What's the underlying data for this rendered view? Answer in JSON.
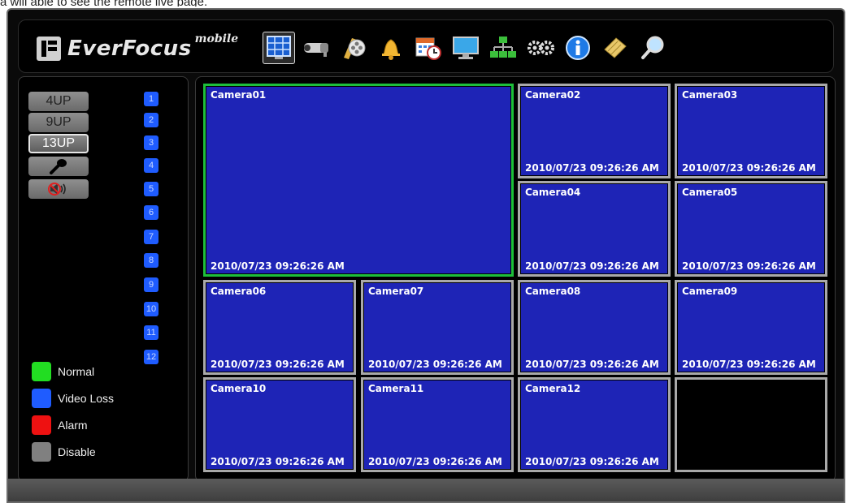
{
  "caption": "a will able to see the remote live page.",
  "header": {
    "brand": "EverFocus",
    "brand_sup": "mobile"
  },
  "toolbar": [
    {
      "icon": "live-view-grid-icon",
      "active": true
    },
    {
      "icon": "camera-icon",
      "active": false
    },
    {
      "icon": "film-reel-icon",
      "active": false
    },
    {
      "icon": "alarm-bell-icon",
      "active": false
    },
    {
      "icon": "calendar-clock-icon",
      "active": false
    },
    {
      "icon": "monitor-icon",
      "active": false
    },
    {
      "icon": "network-icon",
      "active": false
    },
    {
      "icon": "settings-gears-icon",
      "active": false
    },
    {
      "icon": "info-icon",
      "active": false
    },
    {
      "icon": "notes-icon",
      "active": false
    },
    {
      "icon": "search-icon",
      "active": false
    }
  ],
  "layouts": {
    "btn_4up": "4UP",
    "btn_9up": "9UP",
    "btn_13up": "13UP",
    "selected": "13UP"
  },
  "controls": {
    "mic_icon": "microphone-icon",
    "audio_icon": "speaker-muted-icon"
  },
  "channels": [
    "1",
    "2",
    "3",
    "4",
    "5",
    "6",
    "7",
    "8",
    "9",
    "10",
    "11",
    "12"
  ],
  "legend": [
    {
      "label": "Normal",
      "color": "#22dd22"
    },
    {
      "label": "Video Loss",
      "color": "#1f5cff"
    },
    {
      "label": "Alarm",
      "color": "#ee1111"
    },
    {
      "label": "Disable",
      "color": "#808080"
    }
  ],
  "cameras": [
    {
      "name": "Camera01",
      "timestamp": "2010/07/23  09:26:26 AM"
    },
    {
      "name": "Camera02",
      "timestamp": "2010/07/23  09:26:26 AM"
    },
    {
      "name": "Camera03",
      "timestamp": "2010/07/23  09:26:26 AM"
    },
    {
      "name": "Camera04",
      "timestamp": "2010/07/23  09:26:26 AM"
    },
    {
      "name": "Camera05",
      "timestamp": "2010/07/23  09:26:26 AM"
    },
    {
      "name": "Camera06",
      "timestamp": "2010/07/23  09:26:26 AM"
    },
    {
      "name": "Camera07",
      "timestamp": "2010/07/23  09:26:26 AM"
    },
    {
      "name": "Camera08",
      "timestamp": "2010/07/23  09:26:26 AM"
    },
    {
      "name": "Camera09",
      "timestamp": "2010/07/23  09:26:26 AM"
    },
    {
      "name": "Camera10",
      "timestamp": "2010/07/23  09:26:26 AM"
    },
    {
      "name": "Camera11",
      "timestamp": "2010/07/23  09:26:26 AM"
    },
    {
      "name": "Camera12",
      "timestamp": "2010/07/23  09:26:26 AM"
    }
  ],
  "colors": {
    "video_bg": "#1e24b6",
    "focus_border": "#1dbf3a",
    "tile_border": "#a9a9a9"
  }
}
